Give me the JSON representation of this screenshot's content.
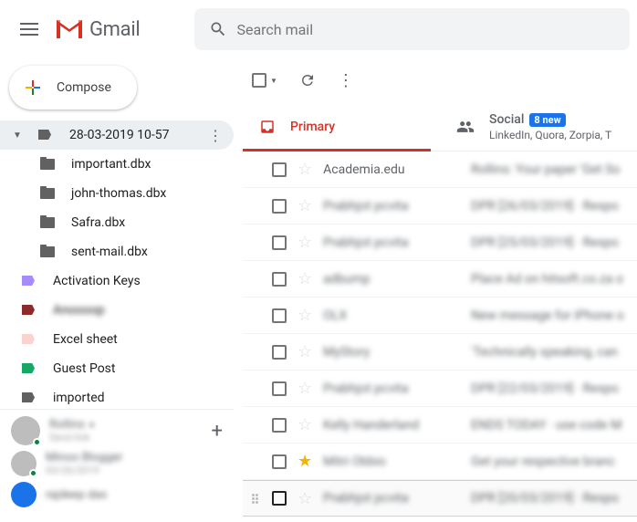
{
  "header": {
    "logo_text": "Gmail",
    "search_placeholder": "Search mail"
  },
  "compose_label": "Compose",
  "sidebar": {
    "selected": {
      "label": "28-03-2019 10-57"
    },
    "files": [
      {
        "label": "important.dbx"
      },
      {
        "label": "john-thomas.dbx"
      },
      {
        "label": "Safra.dbx"
      },
      {
        "label": "sent-mail.dbx"
      }
    ],
    "labels": [
      {
        "label": "Activation Keys",
        "color": "#a78bfa"
      },
      {
        "label": "Anoooop",
        "color": "#8b2b2b",
        "blur": true
      },
      {
        "label": "Excel sheet",
        "color": "#fce8e6"
      },
      {
        "label": "Guest Post",
        "color": "#16a765"
      },
      {
        "label": "imported",
        "color": "#616161"
      }
    ]
  },
  "hangouts": {
    "me": {
      "name": "Rollins",
      "sub": "Send link"
    },
    "contacts": [
      {
        "name": "Minoo Blogger",
        "sub": "03/26/2019"
      },
      {
        "name": "rajdeep das",
        "sub": ""
      }
    ]
  },
  "tabs": {
    "primary": "Primary",
    "social": {
      "label": "Social",
      "badge": "8 new",
      "sub": "LinkedIn, Quora, Zorpia, T"
    }
  },
  "emails": [
    {
      "sender": "Academia.edu",
      "subject": "Rollins: Your paper 'Get So",
      "star": false
    },
    {
      "sender": "Prabhjot pcvita",
      "subject": "DPR [26/03/2019] · Respo",
      "star": false
    },
    {
      "sender": "Prabhjot pcvita",
      "subject": "DPR [25/03/2019] · Respo",
      "star": false
    },
    {
      "sender": "adbump",
      "subject": "Place Ad on hitsoft.co.za o",
      "star": false
    },
    {
      "sender": "OLX",
      "subject": "New message for iPhone o",
      "star": false
    },
    {
      "sender": "MyStory",
      "subject": "'Technically speaking, can",
      "star": false
    },
    {
      "sender": "Prabhjot pcvita",
      "subject": "DPR [22/03/2019] · Respo",
      "star": false
    },
    {
      "sender": "Kelly Handerland",
      "subject": "ENDS TODAY · use code M",
      "star": false
    },
    {
      "sender": "Mitri Obbio",
      "subject": "Get your respective branc",
      "star": true
    },
    {
      "sender": "Prabhjot pcvita",
      "subject": "DPR [20/03/2019] · Respo",
      "star": false
    }
  ]
}
